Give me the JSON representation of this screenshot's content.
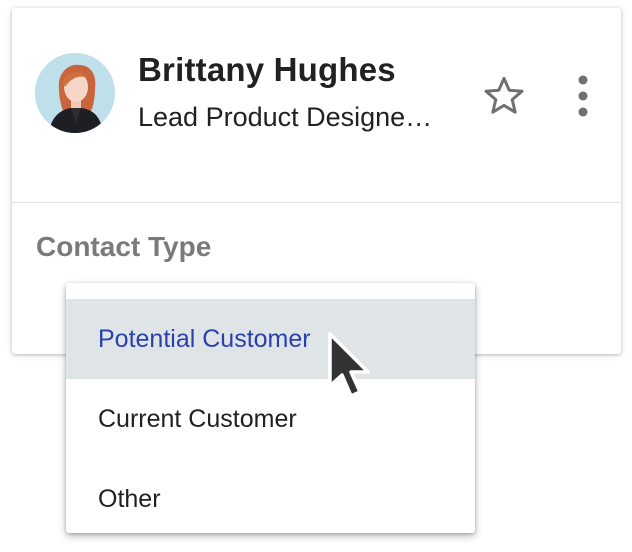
{
  "contact": {
    "name": "Brittany Hughes",
    "title": "Lead Product Designe…",
    "avatar_icon": "person-photo-icon"
  },
  "actions": {
    "star_icon": "star-outline-icon",
    "more_icon": "more-vertical-icon"
  },
  "contact_type": {
    "label": "Contact Type",
    "options": [
      {
        "label": "Potential Customer",
        "highlighted": true
      },
      {
        "label": "Current Customer",
        "highlighted": false
      },
      {
        "label": "Other",
        "highlighted": false
      }
    ]
  },
  "colors": {
    "highlight_bg": "#dfe4e7",
    "highlight_text": "#2b3fb0",
    "label_gray": "#7a7a7a",
    "text": "#212121"
  }
}
